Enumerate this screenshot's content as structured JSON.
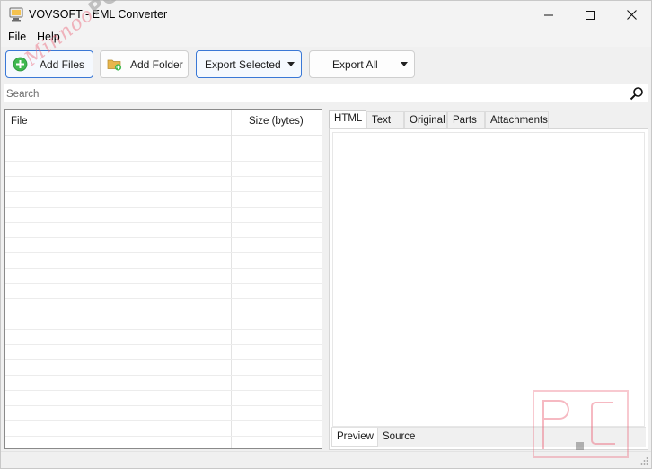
{
  "window": {
    "title": "VOVSOFT - EML Converter",
    "controls": {
      "minimize": "minimize",
      "maximize": "maximize",
      "close": "close"
    }
  },
  "menu": {
    "items": [
      {
        "label": "File"
      },
      {
        "label": "Help"
      }
    ]
  },
  "toolbar": {
    "add_files": {
      "label": "Add Files",
      "icon": "plus-circle-icon"
    },
    "add_folder": {
      "label": "Add Folder",
      "icon": "folder-add-icon"
    },
    "export_selected": {
      "label": "Export Selected",
      "icon": "chevron-down-icon"
    },
    "export_all": {
      "label": "Export All",
      "icon": "chevron-down-icon"
    }
  },
  "search": {
    "placeholder": "Search",
    "value": ""
  },
  "file_list": {
    "columns": [
      {
        "label": "File"
      },
      {
        "label": "Size (bytes)"
      }
    ],
    "rows": []
  },
  "viewer": {
    "tabs": [
      {
        "label": "HTML",
        "active": true
      },
      {
        "label": "Text",
        "active": false
      },
      {
        "label": "Original",
        "active": false
      },
      {
        "label": "Parts",
        "active": false
      },
      {
        "label": "Attachments",
        "active": false
      }
    ],
    "subtabs": [
      {
        "label": "Preview",
        "active": true
      },
      {
        "label": "Source",
        "active": false
      }
    ]
  },
  "watermark": {
    "diagonal_text": "Minnoo",
    "diagonal_brand": "PC",
    "logo_letters": "PC"
  },
  "colors": {
    "accent_focus": "#3a78d6",
    "add_green": "#3fb950",
    "folder_yellow": "#e8b64c",
    "watermark_pink": "#eb6478"
  }
}
